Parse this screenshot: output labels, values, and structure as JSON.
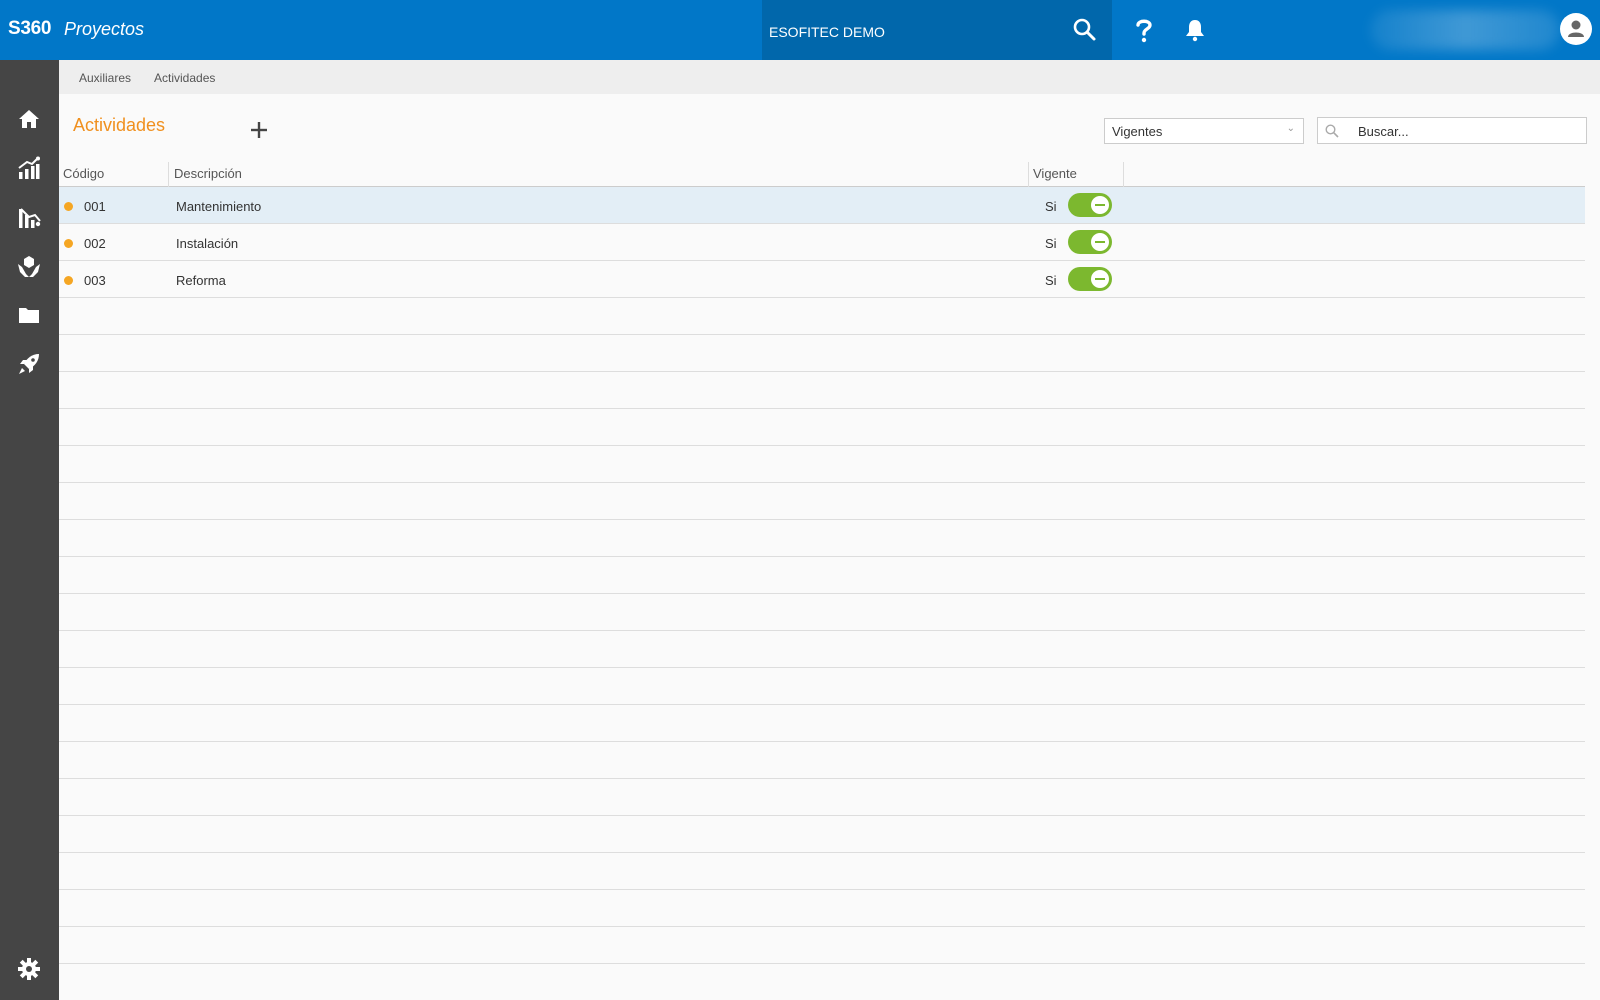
{
  "header": {
    "brand": "S360",
    "module": "Proyectos",
    "company": "ESOFITEC DEMO"
  },
  "sidebar": {
    "items": [
      {
        "icon": "home-icon"
      },
      {
        "icon": "chart-growth-icon"
      },
      {
        "icon": "chart-decline-icon"
      },
      {
        "icon": "hands-icon"
      },
      {
        "icon": "folder-icon"
      },
      {
        "icon": "rocket-icon"
      }
    ],
    "settings_icon": "gear-icon"
  },
  "breadcrumb": {
    "items": [
      "Auxiliares",
      "Actividades"
    ]
  },
  "page": {
    "title": "Actividades",
    "filter_value": "Vigentes",
    "search_placeholder": "Buscar..."
  },
  "table": {
    "columns": [
      "Código",
      "Descripción",
      "Vigente"
    ],
    "rows": [
      {
        "code": "001",
        "description": "Mantenimiento",
        "vigente": "Si"
      },
      {
        "code": "002",
        "description": "Instalación",
        "vigente": "Si"
      },
      {
        "code": "003",
        "description": "Reforma",
        "vigente": "Si"
      }
    ]
  },
  "colors": {
    "header_bg": "#0177c8",
    "company_bg": "#0167ab",
    "sidebar_bg": "#454545",
    "title": "#f0901e",
    "status_dot": "#f5a623",
    "toggle_on": "#7cb82f",
    "selected_row": "#e3eef6"
  }
}
